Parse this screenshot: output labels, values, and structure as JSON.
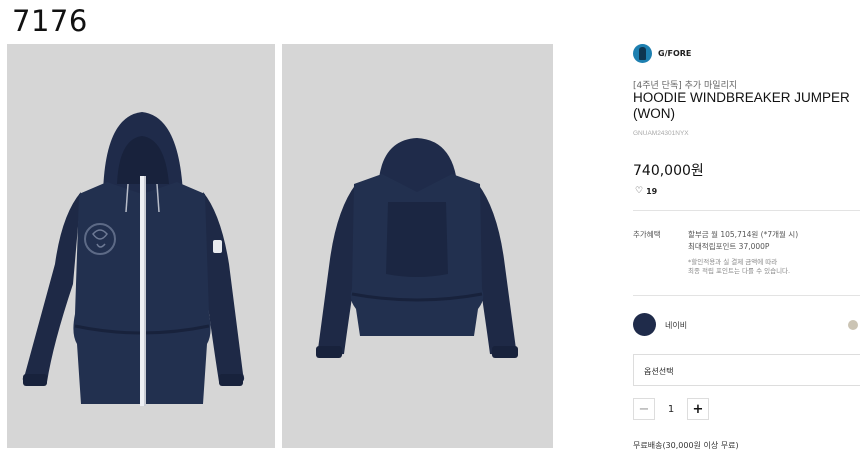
{
  "page": {
    "id_label": "7176"
  },
  "gallery": {
    "front_alt": "front-view product photo",
    "back_alt": "back-view product photo",
    "background_color": "#d6d6d6",
    "jacket_color": "#1f2b4a"
  },
  "product": {
    "brand": "G/FORE",
    "promo": "[4주년 단독] 추가 마일리지",
    "title": "HOODIE WINDBREAKER JUMPER(WON)",
    "code": "GNUAM24301NYX",
    "price": "740,000원",
    "likes": "19",
    "benefit_label": "추가혜택",
    "benefit_installment": "할부금 월 105,714원 (*7개월 시)",
    "benefit_points": "최대적립포인트 37,000P",
    "benefit_note_1": "*할인적용과 실 결제 금액에 따라",
    "benefit_note_2": "최종 적립 포인트는 다를 수 있습니다.",
    "color_name": "네이비",
    "colors": {
      "selected": "#1f2b4a",
      "alternate": "#cbc4b4"
    },
    "option_placeholder": "옵션선택",
    "quantity": "1",
    "minus_label": "−",
    "plus_label": "+",
    "shipping": "무료배송(30,000원 이상 무료)"
  }
}
